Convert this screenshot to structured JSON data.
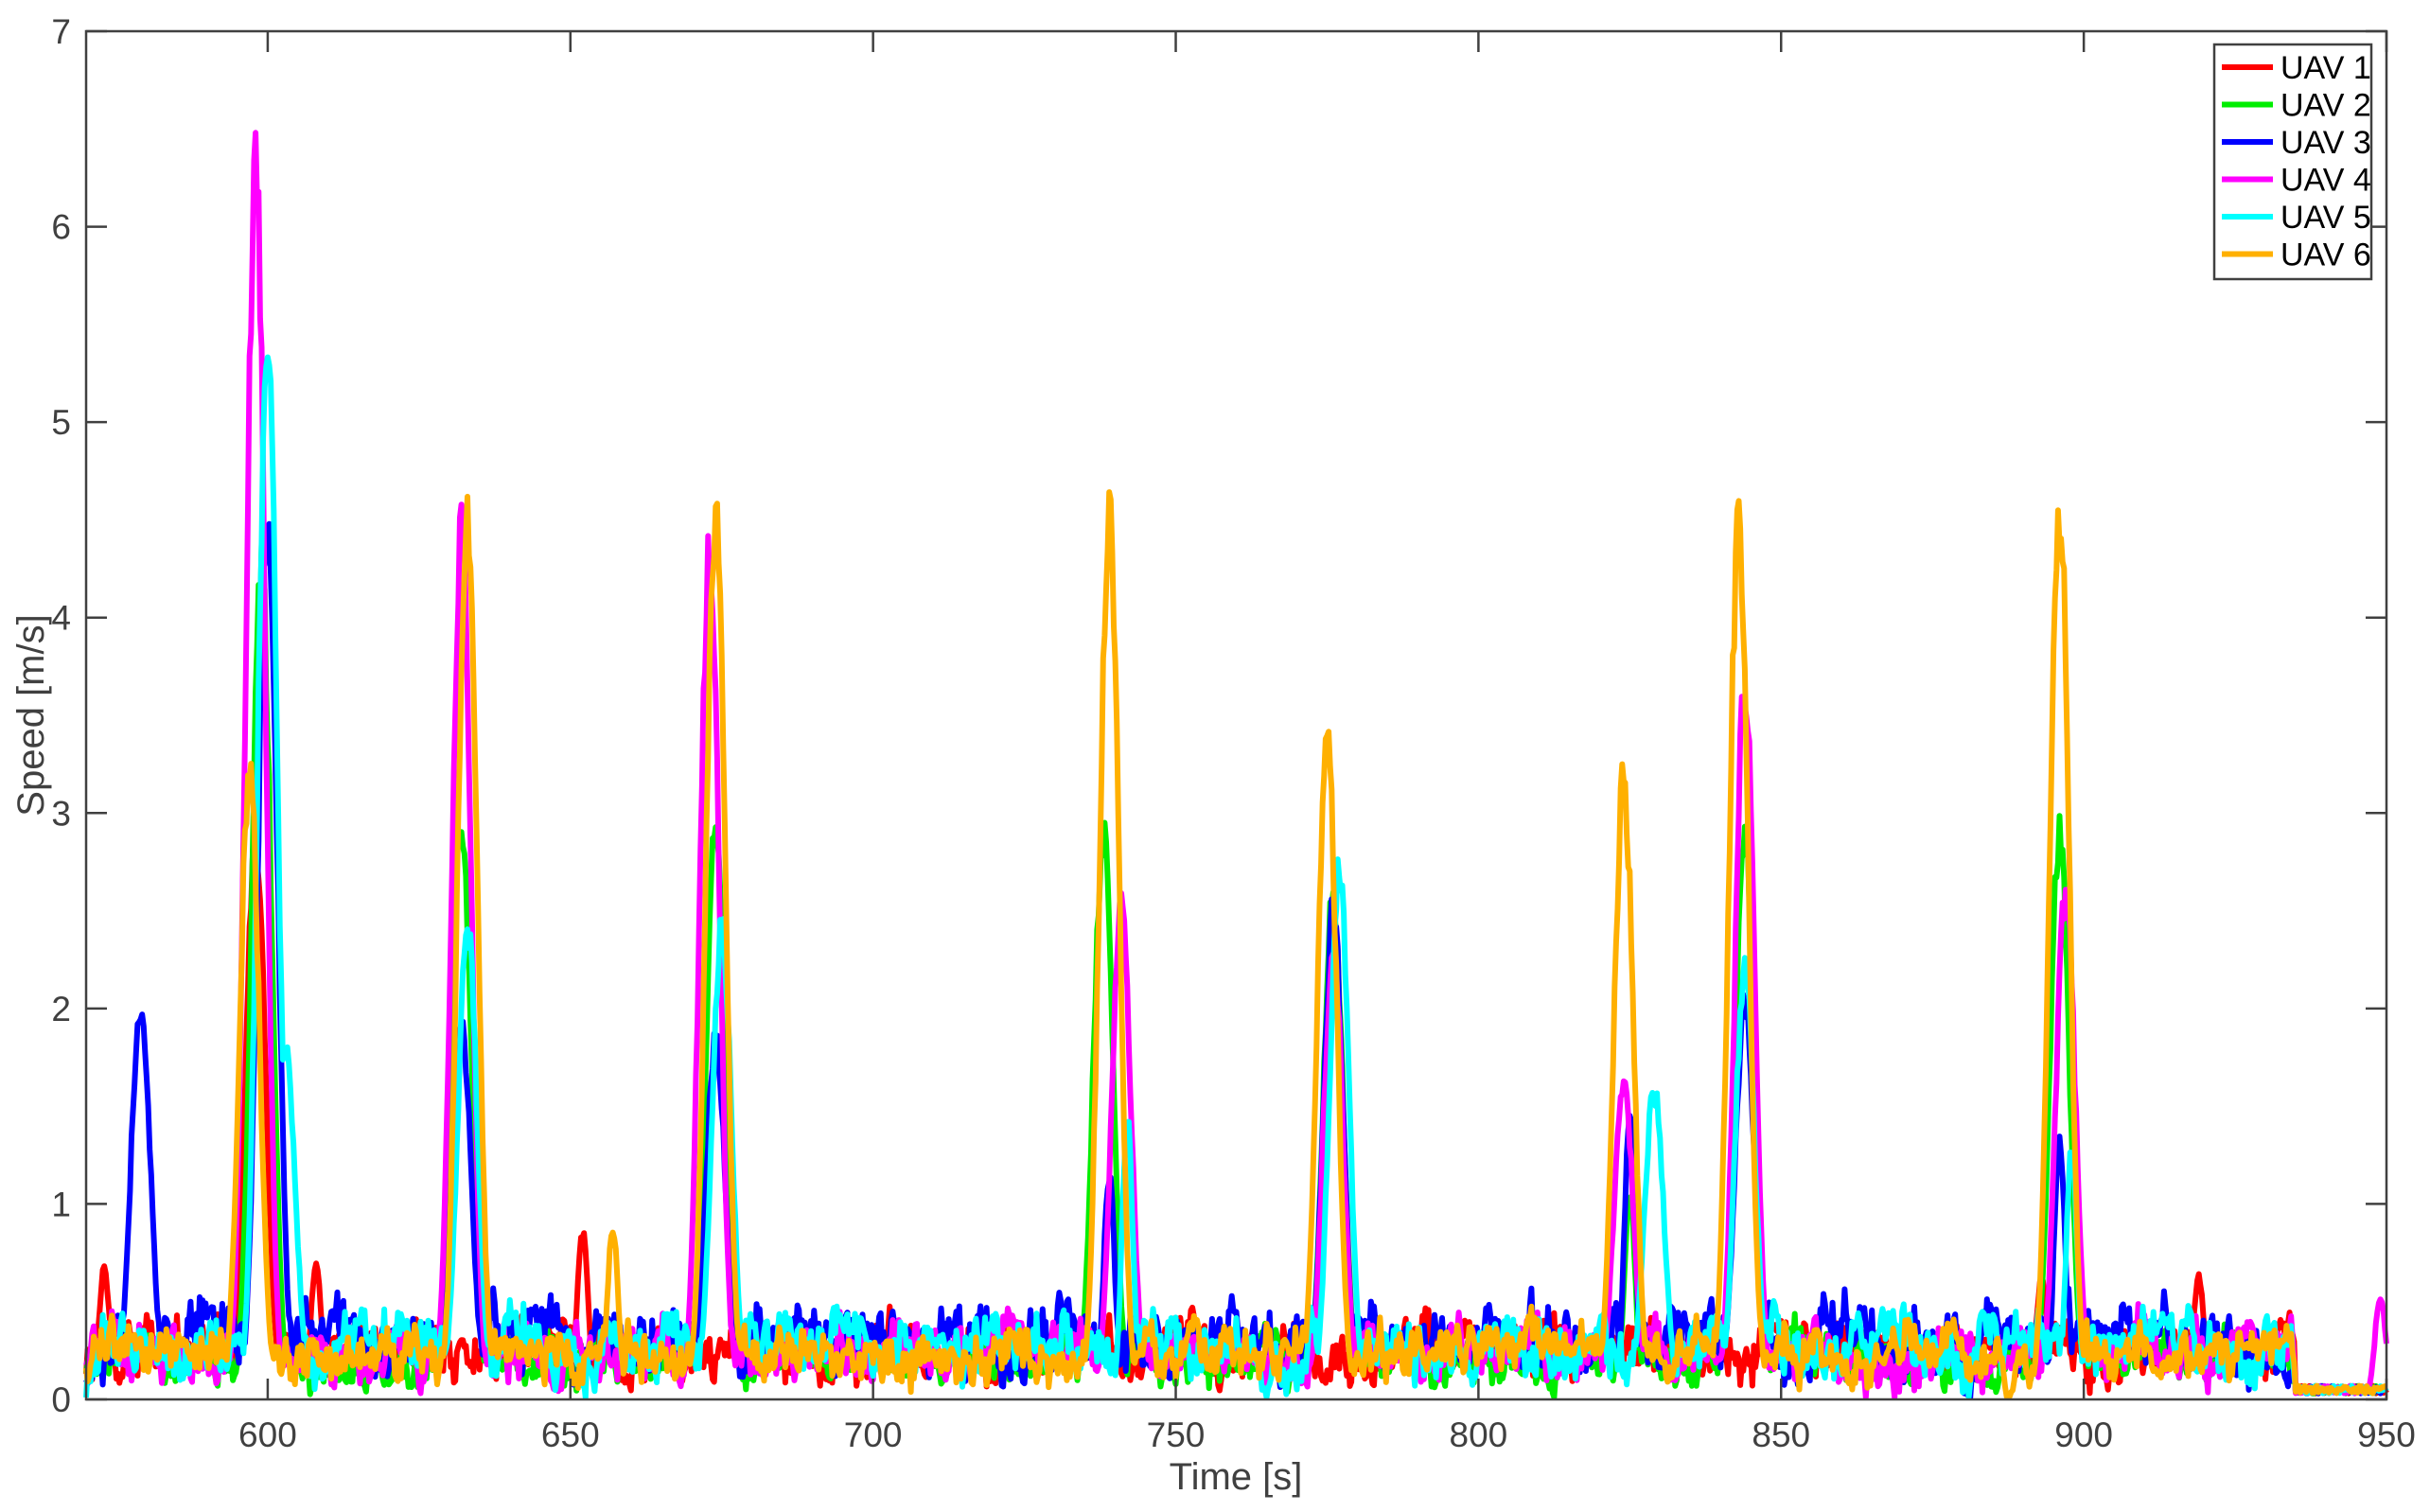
{
  "chart_data": {
    "type": "line",
    "title": "",
    "xlabel": "Time [s]",
    "ylabel": "Speed [m/s]",
    "xlim": [
      570,
      950
    ],
    "ylim": [
      0,
      7
    ],
    "xticks": [
      600,
      650,
      700,
      750,
      800,
      850,
      900,
      950
    ],
    "yticks": [
      0,
      1,
      2,
      3,
      4,
      5,
      6,
      7
    ],
    "grid": false,
    "legend_position": "top-right",
    "baseline_note": "noisy low-speed hover between peaks, ~0-0.5 m/s until ~935 s, ~0.05 m/s after",
    "series": [
      {
        "name": "UAV 1",
        "color": "#ff0000",
        "baseline": 0.18,
        "peaks": [
          [
            573,
            0.7
          ],
          [
            598,
            3.0
          ],
          [
            652,
            0.9
          ],
          [
            608,
            0.7
          ],
          [
            893,
            0.65
          ],
          [
            919,
            0.65
          ]
        ]
      },
      {
        "name": "UAV 2",
        "color": "#00ee00",
        "baseline": 0.15,
        "peaks": [
          [
            599,
            4.4
          ],
          [
            632,
            3.1
          ],
          [
            674,
            3.1
          ],
          [
            738,
            3.0
          ],
          [
            776,
            2.7
          ],
          [
            825,
            1.1
          ],
          [
            844,
            3.0
          ],
          [
            896,
            3.0
          ]
        ]
      },
      {
        "name": "UAV 3",
        "color": "#0000ff",
        "baseline": 0.22,
        "peaks": [
          [
            579,
            2.1
          ],
          [
            600,
            4.8
          ],
          [
            632,
            2.0
          ],
          [
            674,
            1.9
          ],
          [
            739,
            1.2
          ],
          [
            776,
            2.6
          ],
          [
            825,
            1.5
          ],
          [
            844,
            2.1
          ],
          [
            896,
            1.4
          ]
        ]
      },
      {
        "name": "UAV 4",
        "color": "#ff00ff",
        "baseline": 0.18,
        "peaks": [
          [
            598,
            6.55
          ],
          [
            632,
            4.6
          ],
          [
            673,
            4.5
          ],
          [
            741,
            2.6
          ],
          [
            776,
            2.4
          ],
          [
            824,
            1.7
          ],
          [
            844,
            3.8
          ],
          [
            897,
            2.7
          ],
          [
            949,
            0.55
          ]
        ]
      },
      {
        "name": "UAV 5",
        "color": "#00ffff",
        "baseline": 0.2,
        "peaks": [
          [
            600,
            5.7
          ],
          [
            603,
            1.85
          ],
          [
            633,
            2.5
          ],
          [
            675,
            2.5
          ],
          [
            742,
            1.5
          ],
          [
            777,
            2.8
          ],
          [
            829,
            1.65
          ],
          [
            844,
            2.3
          ],
          [
            898,
            1.35
          ]
        ]
      },
      {
        "name": "UAV 6",
        "color": "#ffb000",
        "baseline": 0.17,
        "peaks": [
          [
            597,
            3.35
          ],
          [
            633,
            4.7
          ],
          [
            674,
            4.65
          ],
          [
            739,
            4.72
          ],
          [
            775,
            3.5
          ],
          [
            824,
            3.3
          ],
          [
            843,
            4.65
          ],
          [
            896,
            4.75
          ],
          [
            657,
            0.9
          ]
        ]
      }
    ]
  }
}
